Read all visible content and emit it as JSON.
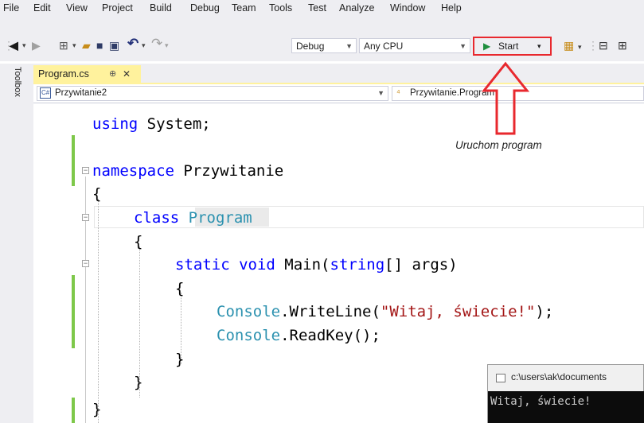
{
  "menu": {
    "items": [
      "File",
      "Edit",
      "View",
      "Project",
      "Build",
      "Debug",
      "Team",
      "Tools",
      "Test",
      "Analyze",
      "Window",
      "Help"
    ]
  },
  "toolbar": {
    "configuration": "Debug",
    "platform": "Any CPU",
    "start_label": "Start"
  },
  "toolbox": {
    "label": "Toolbox"
  },
  "tabs": [
    {
      "label": "Program.cs",
      "pin": "⊕",
      "close": "✕"
    }
  ],
  "navbar": {
    "project": "Przywitanie2",
    "class": "Przywitanie.Program",
    "project_icon": "C#",
    "class_icon": "⁴"
  },
  "code": {
    "line1_kw": "using",
    "line1_rest": " System;",
    "line2_kw": "namespace",
    "line2_rest": " Przywitanie",
    "line3": "{",
    "line4_kw": "class",
    "line4_type": "Program",
    "line5": "{",
    "line6_kw1": "static",
    "line6_kw2": "void",
    "line6_name": " Main(",
    "line6_kw3": "string",
    "line6_rest": "[] args)",
    "line7": "{",
    "line8_type": "Console",
    "line8_mid": ".WriteLine(",
    "line8_str": "\"Witaj, świecie!\"",
    "line8_end": ");",
    "line9_type": "Console",
    "line9_rest": ".ReadKey();",
    "line10": "}",
    "line11": "}",
    "line12": "}"
  },
  "annotation": {
    "text": "Uruchom program",
    "arrow_color": "#e8282e"
  },
  "console": {
    "title": "c:\\users\\ak\\documents",
    "output": "Witaj, świecie!"
  },
  "colors": {
    "chrome": "#eeeef2",
    "active_tab": "#fff29d",
    "keyword": "#0000ff",
    "type": "#2b91af",
    "string": "#a31515",
    "change_bar": "#7ec84a",
    "start_icon": "#1e8e3e"
  }
}
